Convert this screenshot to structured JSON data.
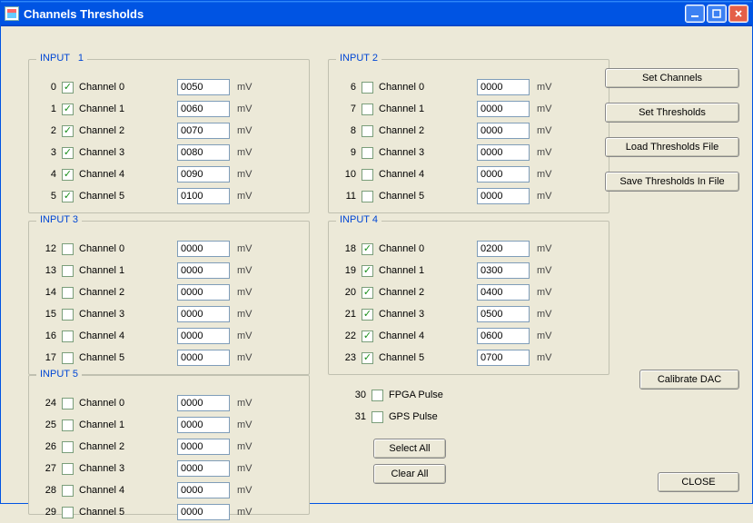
{
  "window": {
    "title": "Channels Thresholds"
  },
  "unit": "mV",
  "groups": [
    {
      "key": "g1",
      "title": "INPUT",
      "suffix": "1",
      "channels": [
        {
          "idx": "0",
          "label": "Channel 0",
          "checked": true,
          "value": "0050"
        },
        {
          "idx": "1",
          "label": "Channel 1",
          "checked": true,
          "value": "0060"
        },
        {
          "idx": "2",
          "label": "Channel 2",
          "checked": true,
          "value": "0070"
        },
        {
          "idx": "3",
          "label": "Channel 3",
          "checked": true,
          "value": "0080"
        },
        {
          "idx": "4",
          "label": "Channel 4",
          "checked": true,
          "value": "0090"
        },
        {
          "idx": "5",
          "label": "Channel 5",
          "checked": true,
          "value": "0100"
        }
      ]
    },
    {
      "key": "g2",
      "title": "INPUT 2",
      "channels": [
        {
          "idx": "6",
          "label": "Channel 0",
          "checked": false,
          "value": "0000"
        },
        {
          "idx": "7",
          "label": "Channel 1",
          "checked": false,
          "value": "0000"
        },
        {
          "idx": "8",
          "label": "Channel 2",
          "checked": false,
          "value": "0000"
        },
        {
          "idx": "9",
          "label": "Channel 3",
          "checked": false,
          "value": "0000"
        },
        {
          "idx": "10",
          "label": "Channel 4",
          "checked": false,
          "value": "0000"
        },
        {
          "idx": "11",
          "label": "Channel 5",
          "checked": false,
          "value": "0000"
        }
      ]
    },
    {
      "key": "g3",
      "title": "INPUT 3",
      "channels": [
        {
          "idx": "12",
          "label": "Channel 0",
          "checked": false,
          "value": "0000"
        },
        {
          "idx": "13",
          "label": "Channel 1",
          "checked": false,
          "value": "0000"
        },
        {
          "idx": "14",
          "label": "Channel 2",
          "checked": false,
          "value": "0000"
        },
        {
          "idx": "15",
          "label": "Channel 3",
          "checked": false,
          "value": "0000"
        },
        {
          "idx": "16",
          "label": "Channel 4",
          "checked": false,
          "value": "0000"
        },
        {
          "idx": "17",
          "label": "Channel 5",
          "checked": false,
          "value": "0000"
        }
      ]
    },
    {
      "key": "g4",
      "title": "INPUT 4",
      "channels": [
        {
          "idx": "18",
          "label": "Channel 0",
          "checked": true,
          "value": "0200"
        },
        {
          "idx": "19",
          "label": "Channel 1",
          "checked": true,
          "value": "0300"
        },
        {
          "idx": "20",
          "label": "Channel 2",
          "checked": true,
          "value": "0400"
        },
        {
          "idx": "21",
          "label": "Channel 3",
          "checked": true,
          "value": "0500"
        },
        {
          "idx": "22",
          "label": "Channel 4",
          "checked": true,
          "value": "0600"
        },
        {
          "idx": "23",
          "label": "Channel 5",
          "checked": true,
          "value": "0700"
        }
      ]
    },
    {
      "key": "g5",
      "title": "INPUT 5",
      "channels": [
        {
          "idx": "24",
          "label": "Channel 0",
          "checked": false,
          "value": "0000"
        },
        {
          "idx": "25",
          "label": "Channel 1",
          "checked": false,
          "value": "0000"
        },
        {
          "idx": "26",
          "label": "Channel 2",
          "checked": false,
          "value": "0000"
        },
        {
          "idx": "27",
          "label": "Channel 3",
          "checked": false,
          "value": "0000"
        },
        {
          "idx": "28",
          "label": "Channel 4",
          "checked": false,
          "value": "0000"
        },
        {
          "idx": "29",
          "label": "Channel 5",
          "checked": false,
          "value": "0000"
        }
      ]
    }
  ],
  "extra": [
    {
      "idx": "30",
      "label": "FPGA Pulse",
      "checked": false
    },
    {
      "idx": "31",
      "label": "GPS Pulse",
      "checked": false
    }
  ],
  "buttons": {
    "set_channels": "Set Channels",
    "set_thresholds": "Set Thresholds",
    "load_file": "Load Thresholds File",
    "save_file": "Save Thresholds In File",
    "calibrate": "Calibrate DAC",
    "select_all": "Select All",
    "clear_all": "Clear All",
    "close": "CLOSE"
  }
}
